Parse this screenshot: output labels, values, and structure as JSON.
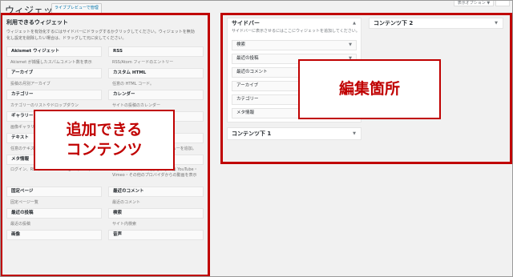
{
  "header": {
    "title": "ウィジェット",
    "live_preview_label": "ライブプレビューで管理",
    "screen_options_label": "表示オプション ▼"
  },
  "available": {
    "title": "利用できるウィジェット",
    "description": "ウィジェットを有効化するにはサイドバーにドラッグするかクリックしてください。ウィジェットを無効化し設定を削除したい場合は、ドラッグして元に戻してください。",
    "widgets": [
      {
        "name": "Akismet ウィジェット",
        "desc": "Akismet が捕獲したスパムコメント数を表示"
      },
      {
        "name": "RSS",
        "desc": "RSS/Atom フィードのエントリー"
      },
      {
        "name": "アーカイブ",
        "desc": "投稿の月別アーカイブ"
      },
      {
        "name": "カスタム HTML",
        "desc": "任意の HTML コード。"
      },
      {
        "name": "カテゴリー",
        "desc": "カテゴリーのリストやドロップダウン"
      },
      {
        "name": "カレンダー",
        "desc": "サイトの投稿のカレンダー"
      },
      {
        "name": "ギャラリー",
        "desc": "画像ギャラリーを表示します。"
      },
      {
        "name": "タグクラウド",
        "desc": "よく使われているタグのクラウド"
      },
      {
        "name": "テキスト",
        "desc": "任意のテキスト。"
      },
      {
        "name": "ナビゲーションメニュー",
        "desc": "サイドバーにナビゲーションメニューを追加。"
      },
      {
        "name": "メタ情報",
        "desc": "ログイン、RSS、WordPress.org へのリンク"
      },
      {
        "name": "動画",
        "desc": "メディアライブラリ内から、または YouTube・Vimeo・その他のプロバイダからの動画を表示"
      },
      {
        "name": "固定ページ",
        "desc": "固定ページ一覧"
      },
      {
        "name": "最近のコメント",
        "desc": "最近のコメント"
      },
      {
        "name": "最近の投稿",
        "desc": "最近の投稿"
      },
      {
        "name": "検索",
        "desc": "サイト内検索"
      },
      {
        "name": "画像",
        "desc": ""
      },
      {
        "name": "音声",
        "desc": ""
      }
    ]
  },
  "sidebar": {
    "title": "サイドバー",
    "description": "サイドバーに表示させるにはここにウィジェットを追加してください。",
    "items": [
      {
        "label": "検索"
      },
      {
        "label": "最近の投稿"
      },
      {
        "label": "最近のコメント"
      },
      {
        "label": "アーカイブ"
      },
      {
        "label": "カテゴリー"
      },
      {
        "label": "メタ情報"
      }
    ]
  },
  "content_bottom_1": {
    "title": "コンテンツ下 1"
  },
  "content_bottom_2": {
    "title": "コンテンツ下 2"
  },
  "callouts": {
    "left": "追加できる\nコンテンツ",
    "right": "編集箇所"
  },
  "colors": {
    "highlight": "#c00000",
    "link": "#0073aa"
  }
}
